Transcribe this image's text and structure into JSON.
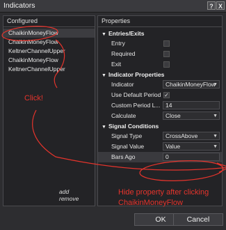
{
  "window": {
    "title": "Indicators",
    "help_label": "?",
    "close_label": "X"
  },
  "configured": {
    "header": "Configured",
    "items": [
      {
        "label": "ChaikinMoneyFlow"
      },
      {
        "label": "ChaikinMoneyFlow"
      },
      {
        "label": "KeltnerChannelUpper"
      },
      {
        "label": "ChaikinMoneyFlow"
      },
      {
        "label": "KeltnerChannelUpper"
      }
    ],
    "add_label": "add",
    "remove_label": "remove"
  },
  "properties": {
    "header": "Properties",
    "sections": [
      {
        "title": "Entries/Exits",
        "rows": [
          {
            "name": "Entry",
            "type": "checkbox",
            "checked": ""
          },
          {
            "name": "Required",
            "type": "checkbox",
            "checked": ""
          },
          {
            "name": "Exit",
            "type": "checkbox",
            "checked": ""
          }
        ]
      },
      {
        "title": "Indicator Properties",
        "rows": [
          {
            "name": "Indicator",
            "type": "select",
            "value": "ChaikinMoneyFlow"
          },
          {
            "name": "Use Default Period",
            "type": "checkbox",
            "checked": "✓"
          },
          {
            "name": "Custom Period L...",
            "type": "text",
            "value": "14"
          },
          {
            "name": "Calculate",
            "type": "select",
            "value": "Close"
          }
        ]
      },
      {
        "title": "Signal Conditions",
        "rows": [
          {
            "name": "Signal Type",
            "type": "select",
            "value": "CrossAbove"
          },
          {
            "name": "Signal Value",
            "type": "select",
            "value": "Value"
          },
          {
            "name": "Bars Ago",
            "type": "text",
            "value": "0"
          }
        ]
      }
    ]
  },
  "buttons": {
    "ok": "OK",
    "cancel": "Cancel"
  },
  "annotations": {
    "click_text": "Click!",
    "hide_line1": "Hide property after clicking",
    "hide_line2": "ChaikinMoneyFlow",
    "color": "#e6342c"
  },
  "icons": {
    "section_caret": "▼",
    "dropdown": "▼"
  }
}
